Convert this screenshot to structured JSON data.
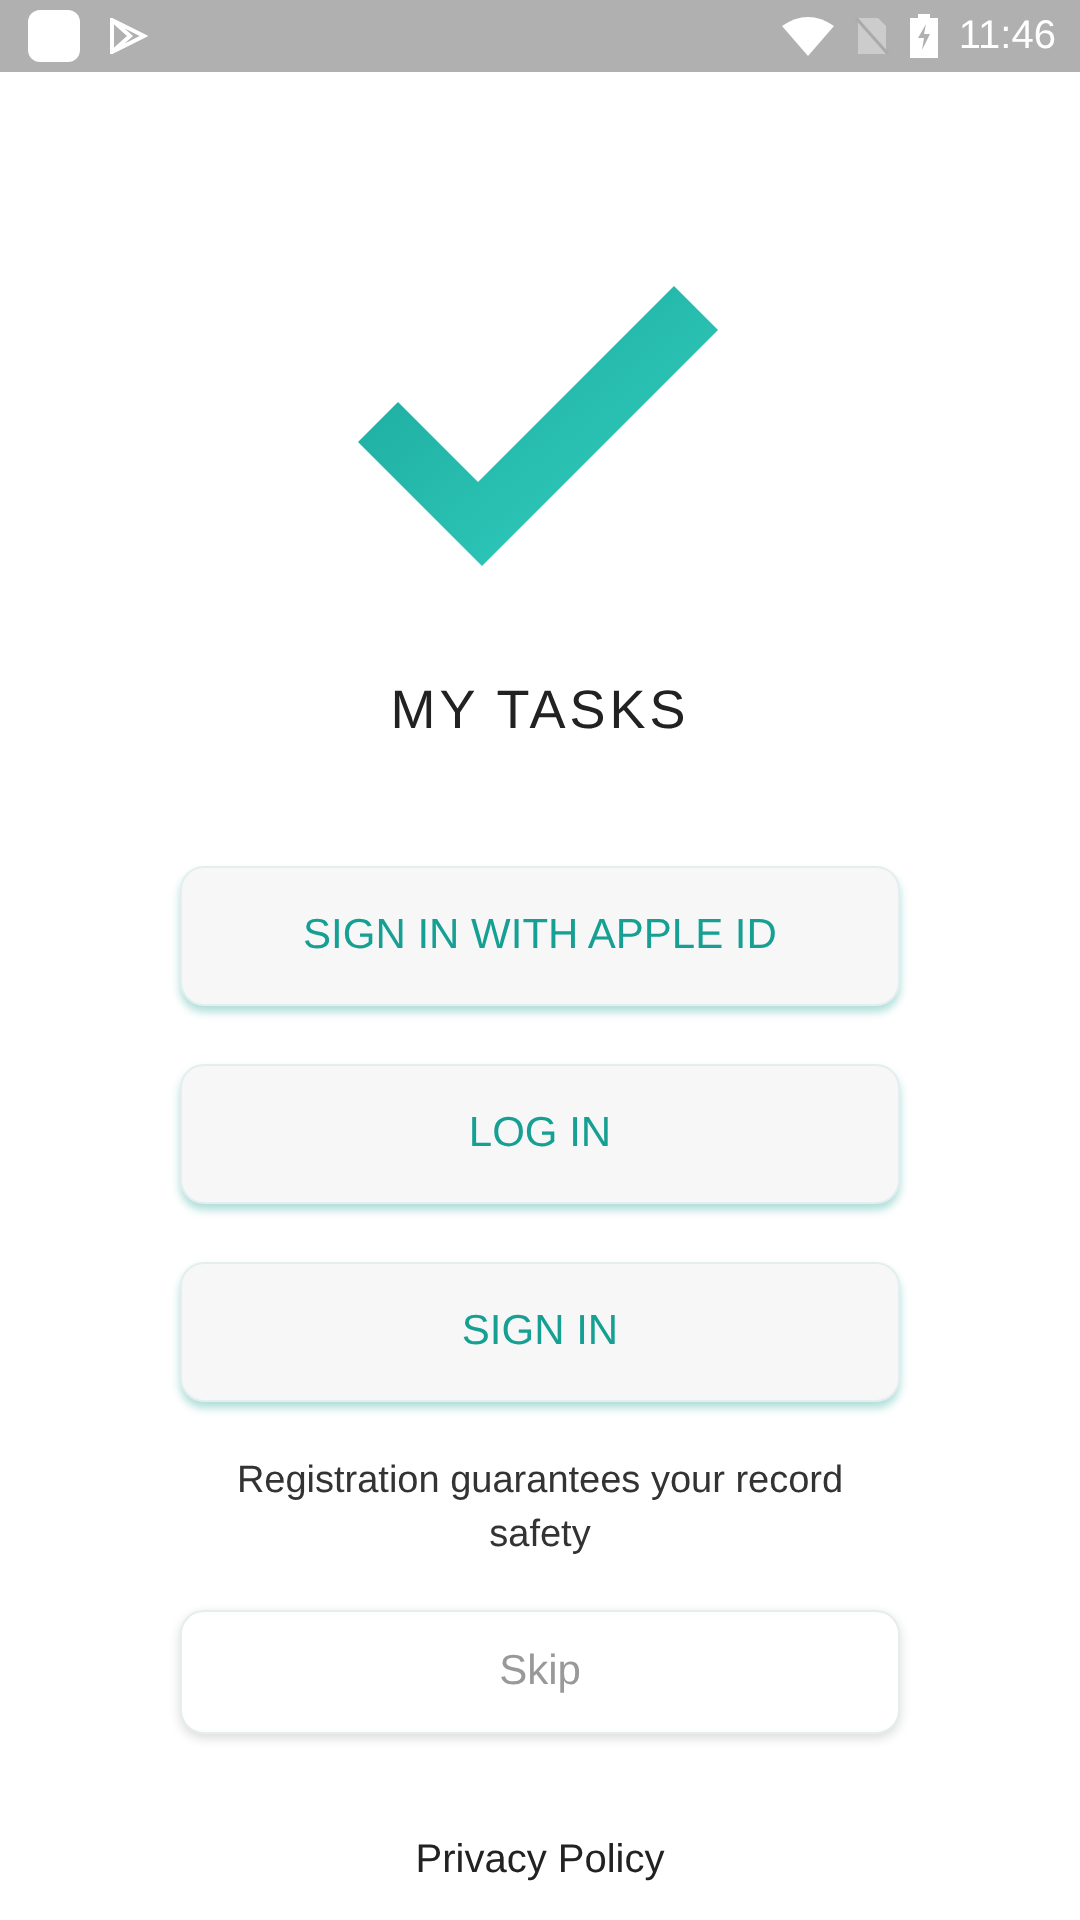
{
  "status_bar": {
    "time": "11:46"
  },
  "app_title": "MY TASKS",
  "buttons": [
    {
      "label": "SIGN IN WITH APPLE ID",
      "kind": "primary"
    },
    {
      "label": "LOG IN",
      "kind": "primary"
    },
    {
      "label": "SIGN IN",
      "kind": "primary"
    }
  ],
  "note": "Registration guarantees your record safety",
  "skip_button": {
    "label": "Skip",
    "kind": "secondary"
  },
  "privacy_link": "Privacy Policy"
}
